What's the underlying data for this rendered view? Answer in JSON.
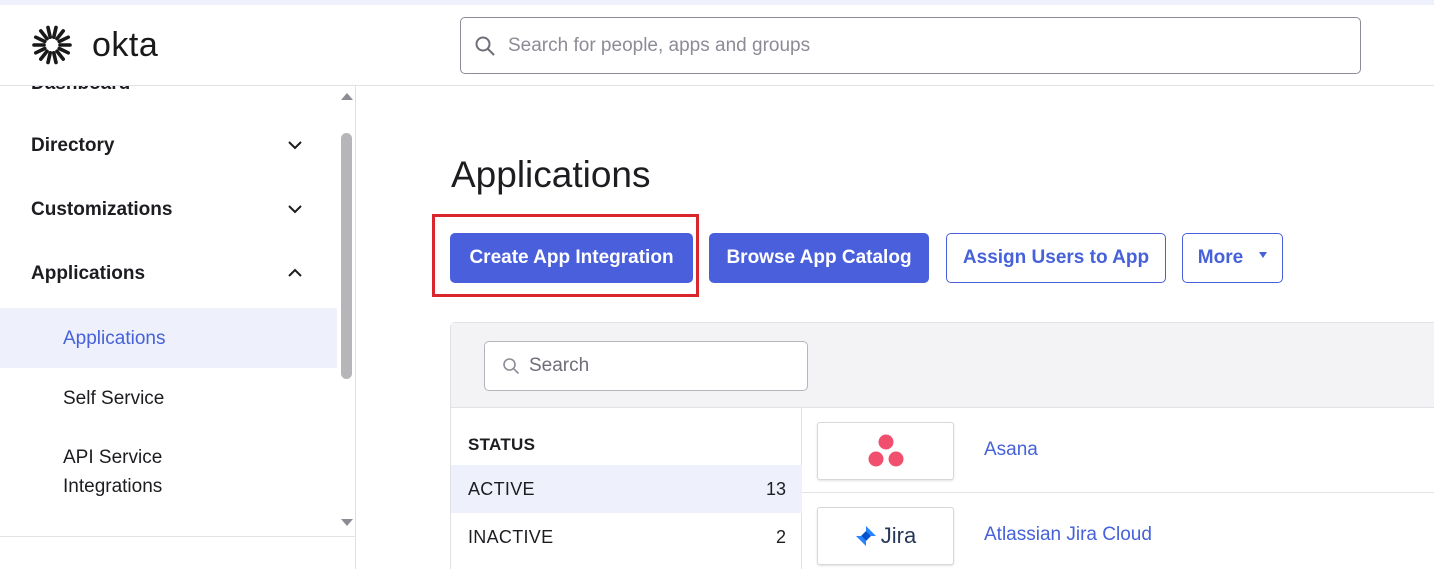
{
  "brand": {
    "name": "okta"
  },
  "header": {
    "search_placeholder": "Search for people, apps and groups"
  },
  "sidebar": {
    "partial_item": "Dashboard",
    "sections": [
      {
        "label": "Directory",
        "expanded": false
      },
      {
        "label": "Customizations",
        "expanded": false
      },
      {
        "label": "Applications",
        "expanded": true
      }
    ],
    "subitems": [
      {
        "label": "Applications",
        "active": true
      },
      {
        "label": "Self Service",
        "active": false
      },
      {
        "label": "API Service Integrations",
        "active": false
      }
    ]
  },
  "main": {
    "title": "Applications",
    "buttons": {
      "create": "Create App Integration",
      "browse": "Browse App Catalog",
      "assign": "Assign Users to App",
      "more": "More"
    },
    "list_search_placeholder": "Search",
    "status": {
      "title": "STATUS",
      "rows": [
        {
          "label": "ACTIVE",
          "count": "13",
          "active": true
        },
        {
          "label": "INACTIVE",
          "count": "2",
          "active": false
        }
      ]
    },
    "apps": [
      {
        "name": "Asana",
        "logo_icon": "asana-logo-icon"
      },
      {
        "name": "Atlassian Jira Cloud",
        "logo_icon": "jira-logo-icon",
        "logo_text": "Jira"
      }
    ]
  },
  "colors": {
    "primary": "#4a5fdc",
    "link": "#4661d9",
    "highlight": "#d9262d",
    "active_bg": "#eef0fb"
  }
}
